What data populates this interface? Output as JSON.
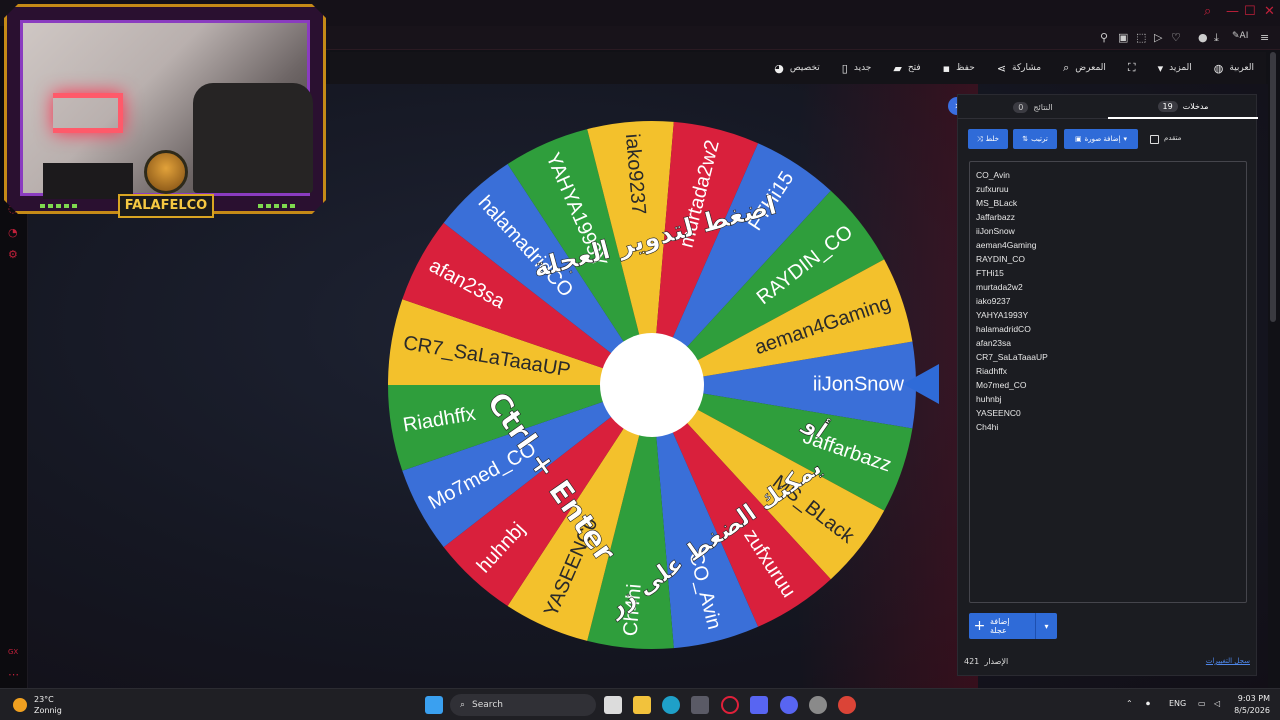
{
  "toolbar": {
    "language": "العربية",
    "more": "المزيد",
    "gallery": "المعرض",
    "share": "مشاركة",
    "save": "حفظ",
    "open": "فتح",
    "new": "جديد",
    "customize": "تخصيص"
  },
  "browser_tab_label": "AI",
  "webcam": {
    "logo_text": "FALAFELCO"
  },
  "wheel": {
    "instruction_top": "اضغط لتدوير العجلة",
    "instruction_or": "أو",
    "instruction_bottom": "يمكنك الضغط على زر",
    "shortcut": "Ctrl + Enter",
    "segment_colors": [
      "#3a6fd8",
      "#2f9e3c",
      "#f3c12c",
      "#d9203c"
    ]
  },
  "panel": {
    "tabs": [
      {
        "label": "مدخلات",
        "count": "19"
      },
      {
        "label": "النتائج",
        "count": "0"
      }
    ],
    "shuffle": "خلط",
    "sort": "ترتيب",
    "add_image": "إضافة صورة",
    "advanced": "متقدم",
    "entries": [
      "CO_Avin",
      "zufxuruu",
      "MS_BLack",
      "Jaffarbazz",
      "iiJonSnow",
      "aeman4Gaming",
      "RAYDIN_CO",
      "FTHi15",
      "murtada2w2",
      "iako9237",
      "YAHYA1993Y",
      "halamadridCO",
      "afan23sa",
      "CR7_SaLaTaaaUP",
      "Riadhffx",
      "Mo7med_CO",
      "huhnbj",
      "YASEENC0",
      "Ch4hi"
    ],
    "wheel_segments": [
      "iiJonSnow",
      "Jaffarbazz",
      "MS_BLack",
      "zufxuruu",
      "CO_Avin",
      "Ch4hi",
      "YASEENC0",
      "huhnbj",
      "Mo7med_CO",
      "Riadhffx",
      "CR7_SaLaTaaaUP",
      "afan23sa",
      "halamadridCO",
      "YAHYA1993Y",
      "iako9237",
      "murtada2w2",
      "FTHi15",
      "RAYDIN_CO",
      "aeman4Gaming"
    ],
    "add_wheel": "إضافة عجلة",
    "version_label": "الإصدار",
    "version_number": "421",
    "changelog": "سجل التغييرات"
  },
  "taskbar": {
    "temperature": "23°C",
    "weather": "Zonnig",
    "search": "Search",
    "language": "ENG",
    "time": "9:03 PM",
    "date": "8/5/2026"
  }
}
